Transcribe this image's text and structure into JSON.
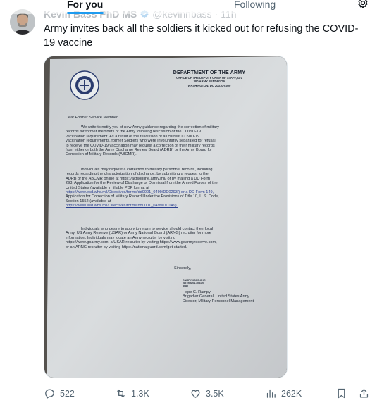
{
  "nav": {
    "tab_for_you": "For you",
    "tab_following": "Following",
    "settings_icon": "gear-icon"
  },
  "tweet": {
    "author_name": "Kevin Bass PhD MS",
    "handle": "@kevinnbass",
    "separator": "·",
    "time": "11h",
    "text": "Army invites back all the soldiers it kicked out for refusing the COVID-19 vaccine",
    "verified_color": "#1d9bf0"
  },
  "letter": {
    "heading": "DEPARTMENT OF THE ARMY",
    "sub1": "OFFICE OF THE DEPUTY CHIEF OF STAFF, G-1",
    "sub2": "300 ARMY PENTAGON",
    "sub3": "WASHINGTON, DC 20310-0300",
    "salutation": "Dear Former Service Member,",
    "para1": [
      "We write to notify you of new Army guidance regarding the correction of military",
      "records for former members of the Army following rescission of the COVID-19",
      "vaccination requirement.  As a result of the rescission of all current COVID-19",
      "vaccination requirements, former Soldiers who were involuntarily separated for refusal",
      "to receive the COVID-19 vaccination may request a correction of their military records",
      "from either or both the Army Discharge Review Board (ADRB) or the Army Board for",
      "Correction of Military Records (ABCMR)."
    ],
    "para2": [
      "Individuals may request a correction to military personnel records, including",
      "records regarding the characterization of discharge, by submitting a request to the",
      "ADRB or the ABCMR online at https://actsonline.army.mil/ or by mailing a DD Form",
      "293, Application for the Review of Discharge or Dismissal from the Armed Forces of the",
      "United States (available in fillable PDF format at",
      "https://www.esd.whs.mil/Directives/forms/dd0001_0499/DD0293/) or a DD Form 149,",
      "Application for Correction of Military Record Under the Provisions of Title 10, U.S. Code,",
      "Section 1552 (available at",
      "https://www.esd.whs.mil/Directives/forms/dd0001_0499/DD149)."
    ],
    "para3": [
      "Individuals who desire to apply to return to service should contact their local",
      "Army, US Army Reserve (USAR) or Army National Guard (ARNG) recruiter for more",
      "information.  Individuals may locate an Army recruiter by visiting",
      "https://www.goarmy.com, a USAR recruiter by visiting https://www.goarmyreserve.com,",
      "or an ARNG recruiter by visiting https://nationalguard.com/get-started."
    ],
    "closing": "Sincerely,",
    "sig_block": [
      "RAMPY.HOPE.CHR",
      "ISTENSEN.103125",
      "3080"
    ],
    "signer": [
      "Hope C. Rampy",
      "Brigadier General, United States Army",
      "Director, Military Personnel Management"
    ]
  },
  "actions": {
    "replies": "522",
    "reposts": "1.3K",
    "likes": "3.5K",
    "views": "262K",
    "reply_icon": "speech-bubble-icon",
    "repost_icon": "repost-icon",
    "like_icon": "heart-icon",
    "views_icon": "bar-chart-icon",
    "bookmark_icon": "bookmark-icon",
    "share_icon": "share-icon"
  }
}
